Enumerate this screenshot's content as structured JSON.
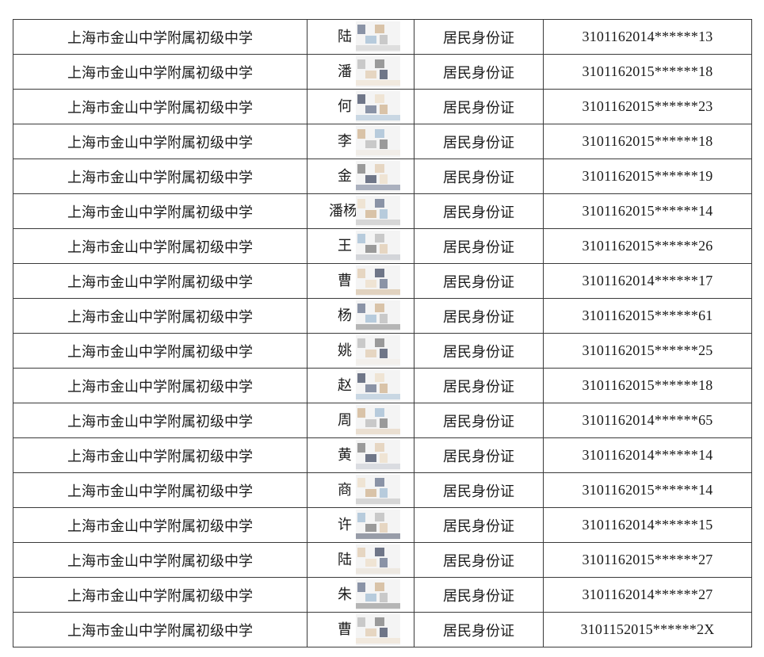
{
  "table": {
    "rows": [
      {
        "school": "上海市金山中学附属初级中学",
        "name": "陆",
        "id_type": "居民身份证",
        "id_number": "3101162014******13"
      },
      {
        "school": "上海市金山中学附属初级中学",
        "name": "潘",
        "id_type": "居民身份证",
        "id_number": "3101162015******18"
      },
      {
        "school": "上海市金山中学附属初级中学",
        "name": "何",
        "id_type": "居民身份证",
        "id_number": "3101162015******23"
      },
      {
        "school": "上海市金山中学附属初级中学",
        "name": "李",
        "id_type": "居民身份证",
        "id_number": "3101162015******18"
      },
      {
        "school": "上海市金山中学附属初级中学",
        "name": "金",
        "id_type": "居民身份证",
        "id_number": "3101162015******19"
      },
      {
        "school": "上海市金山中学附属初级中学",
        "name": "潘杨",
        "id_type": "居民身份证",
        "id_number": "3101162015******14"
      },
      {
        "school": "上海市金山中学附属初级中学",
        "name": "王",
        "id_type": "居民身份证",
        "id_number": "3101162015******26"
      },
      {
        "school": "上海市金山中学附属初级中学",
        "name": "曹",
        "id_type": "居民身份证",
        "id_number": "3101162014******17"
      },
      {
        "school": "上海市金山中学附属初级中学",
        "name": "杨",
        "id_type": "居民身份证",
        "id_number": "3101162015******61"
      },
      {
        "school": "上海市金山中学附属初级中学",
        "name": "姚",
        "id_type": "居民身份证",
        "id_number": "3101162015******25"
      },
      {
        "school": "上海市金山中学附属初级中学",
        "name": "赵",
        "id_type": "居民身份证",
        "id_number": "3101162015******18"
      },
      {
        "school": "上海市金山中学附属初级中学",
        "name": "周",
        "id_type": "居民身份证",
        "id_number": "3101162014******65"
      },
      {
        "school": "上海市金山中学附属初级中学",
        "name": "黄",
        "id_type": "居民身份证",
        "id_number": "3101162014******14"
      },
      {
        "school": "上海市金山中学附属初级中学",
        "name": "商",
        "id_type": "居民身份证",
        "id_number": "3101162015******14"
      },
      {
        "school": "上海市金山中学附属初级中学",
        "name": "许",
        "id_type": "居民身份证",
        "id_number": "3101162014******15"
      },
      {
        "school": "上海市金山中学附属初级中学",
        "name": "陆",
        "id_type": "居民身份证",
        "id_number": "3101162015******27"
      },
      {
        "school": "上海市金山中学附属初级中学",
        "name": "朱",
        "id_type": "居民身份证",
        "id_number": "3101162014******27"
      },
      {
        "school": "上海市金山中学附属初级中学",
        "name": "曹",
        "id_type": "居民身份证",
        "id_number": "3101152015******2X"
      }
    ]
  },
  "redaction": {
    "style": "pixelated-mosaic",
    "colors": [
      "#8a93a6",
      "#d9c3a8",
      "#b7cbdc",
      "#c9c9c9",
      "#9a9a9a",
      "#e6d6c2",
      "#6f7688",
      "#efe4d4"
    ]
  }
}
